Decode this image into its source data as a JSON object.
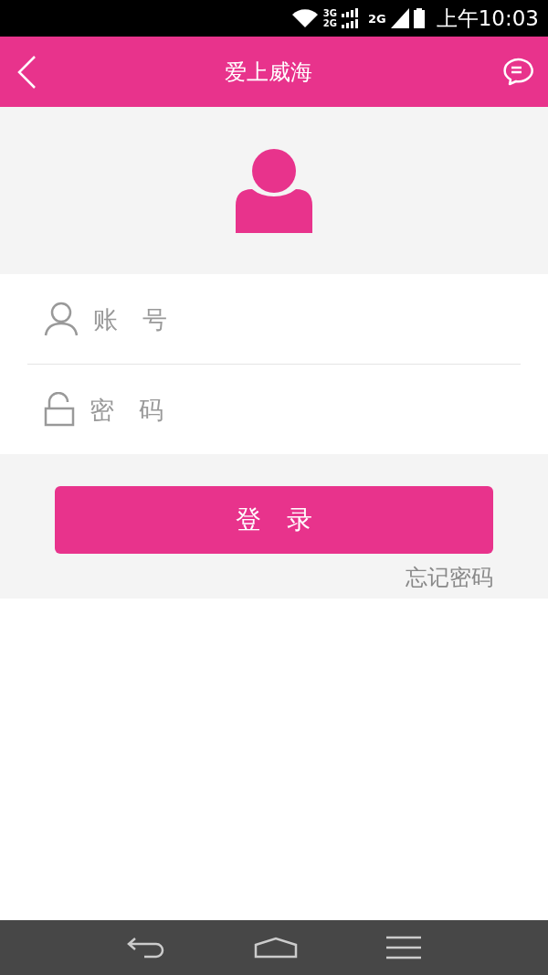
{
  "status_bar": {
    "network_1_top": "3G",
    "network_1_bottom": "2G",
    "network_2": "2G",
    "time": "上午10:03"
  },
  "header": {
    "title": "爱上威海"
  },
  "form": {
    "account": {
      "placeholder": "账　号"
    },
    "password": {
      "placeholder": "密　码"
    }
  },
  "login_button": "登　录",
  "forgot_password": "忘记密码"
}
